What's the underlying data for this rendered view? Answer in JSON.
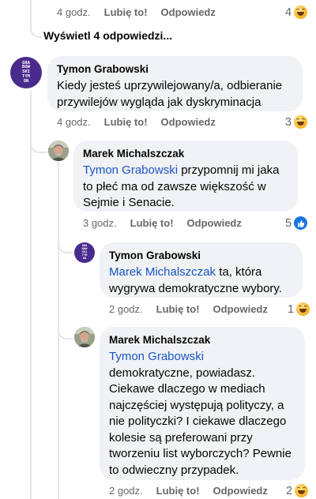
{
  "top_row": {
    "time": "4 godz.",
    "like": "Lubię to!",
    "reply": "Odpowiedz",
    "reaction_count": "4",
    "reaction": "haha-emoji"
  },
  "view_replies": "Wyświetl 4 odpowiedzi...",
  "comments": [
    {
      "author": "Tymon Grabowski",
      "mention": "",
      "text": "Kiedy jesteś uprzywilejowany/a, odbieranie przywilejów wygląda jak dyskryminacja",
      "time": "4 godz.",
      "like": "Lubię to!",
      "reply": "Odpowiedz",
      "reaction_count": "3",
      "reaction": "haha-emoji"
    },
    {
      "author": "Marek Michalszczak",
      "mention": "Tymon Grabowski",
      "text": "przypomnij mi jaka to płeć ma od zawsze większość w Sejmie i Senacie.",
      "time": "3 godz.",
      "like": "Lubię to!",
      "reply": "Odpowiedz",
      "reaction_count": "5",
      "reaction": "like-icon"
    },
    {
      "author": "Tymon Grabowski",
      "mention": "Marek Michalszczak",
      "text": "ta, która wygrywa demokratyczne wybory.",
      "time": "2 godz.",
      "like": "Lubię to!",
      "reply": "Odpowiedz",
      "reaction_count": "1",
      "reaction": "haha-emoji"
    },
    {
      "author": "Marek Michalszczak",
      "mention": "Tymon Grabowski",
      "text": "demokratyczne, powiadasz. Ciekawe dlaczego w mediach najczęściej występują polityczy, a nie polityczki? I ciekawe dlaczego kolesie są preferowani przy tworzeniu list wyborczych? Pewnie to odwieczny przypadek.",
      "time": "2 godz.",
      "like": "Lubię to!",
      "reply": "Odpowiedz",
      "reaction_count": "2",
      "reaction": "haha-emoji"
    }
  ],
  "avatar_logo": [
    "GRA",
    "BOW",
    "SKI",
    "TYM",
    "ON"
  ],
  "colors": {
    "bubble": "#f0f2f5",
    "mention": "#1b55c4",
    "meta": "#65676b",
    "purple_avatar": "#4a2a8c",
    "like_blue": "#1b74e4"
  }
}
